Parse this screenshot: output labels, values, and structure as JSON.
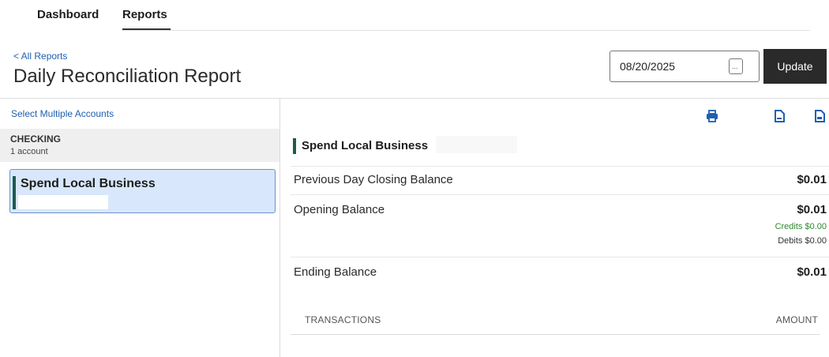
{
  "nav": {
    "tabs": [
      {
        "label": "Dashboard"
      },
      {
        "label": "Reports"
      }
    ]
  },
  "header": {
    "back_link": "< All Reports",
    "title": "Daily Reconciliation Report"
  },
  "controls": {
    "date_value": "08/20/2025",
    "calendar_glyph": "...",
    "update_label": "Update"
  },
  "sidebar": {
    "select_multiple": "Select Multiple Accounts",
    "group": {
      "name": "CHECKING",
      "count": "1 account"
    },
    "accounts": [
      {
        "name": "Spend Local Business",
        "selected": true
      }
    ]
  },
  "detail": {
    "icons": [
      "print-icon",
      "document-icon",
      "document-icon"
    ],
    "account_name": "Spend Local Business",
    "rows": {
      "previous_day_closing": {
        "label": "Previous Day Closing Balance",
        "value": "$0.01"
      },
      "opening": {
        "label": "Opening Balance",
        "value": "$0.01",
        "credits": "Credits $0.00",
        "debits": "Debits $0.00"
      },
      "ending": {
        "label": "Ending Balance",
        "value": "$0.01"
      }
    },
    "columns": {
      "transactions": "TRANSACTIONS",
      "amount": "AMOUNT"
    }
  },
  "colors": {
    "link": "#1f5fb0",
    "accent_bar": "#1f5a4e",
    "credit": "#2e8b2e",
    "update_button": "#2a2a2a",
    "selected_card": "#d8e7fb"
  }
}
